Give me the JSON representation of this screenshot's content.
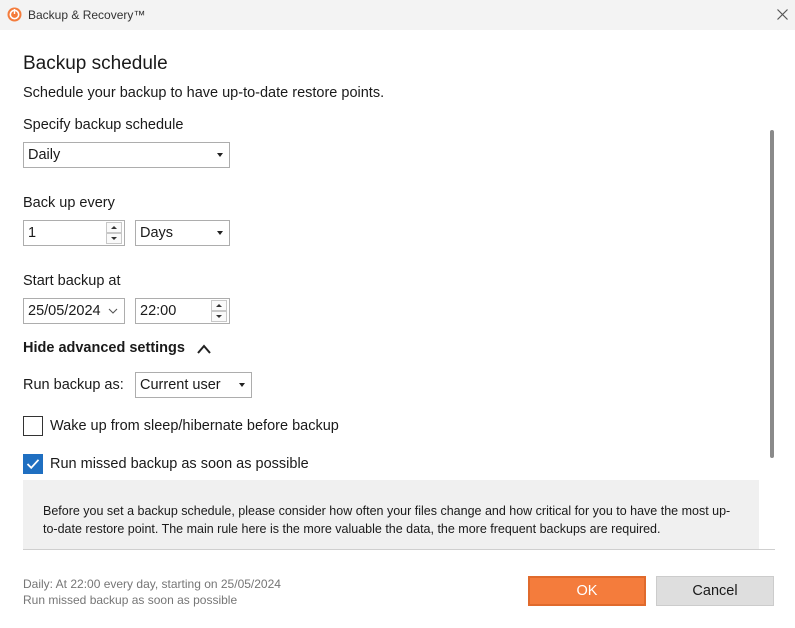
{
  "window": {
    "title": "Backup & Recovery™",
    "icon": "app-logo-icon",
    "brand_color": "#f47c3c"
  },
  "heading": "Backup schedule",
  "subheading": "Schedule your backup to have up-to-date restore points.",
  "schedule": {
    "label": "Specify backup schedule",
    "selected": "Daily"
  },
  "interval": {
    "label": "Back up every",
    "value": "1",
    "unit": "Days"
  },
  "start": {
    "label": "Start backup at",
    "date": "25/05/2024",
    "time": "22:00"
  },
  "advanced": {
    "toggle_label": "Hide advanced settings",
    "run_as_label": "Run backup as:",
    "run_as_value": "Current user",
    "wake_label": "Wake up from sleep/hibernate before backup",
    "wake_checked": false,
    "missed_label": "Run missed backup as soon as possible",
    "missed_checked": true
  },
  "info_text": "Before you set a backup schedule, please consider how often your files change and how critical for you to have the most up-to-date restore point. The main rule here is the more valuable the data, the more frequent backups are required.",
  "summary": {
    "line1": "Daily: At 22:00 every day, starting on 25/05/2024",
    "line2": "Run missed backup as soon as possible"
  },
  "buttons": {
    "ok": "OK",
    "cancel": "Cancel"
  },
  "colors": {
    "accent": "#f47c3c",
    "checkbox": "#1f6fc1"
  }
}
